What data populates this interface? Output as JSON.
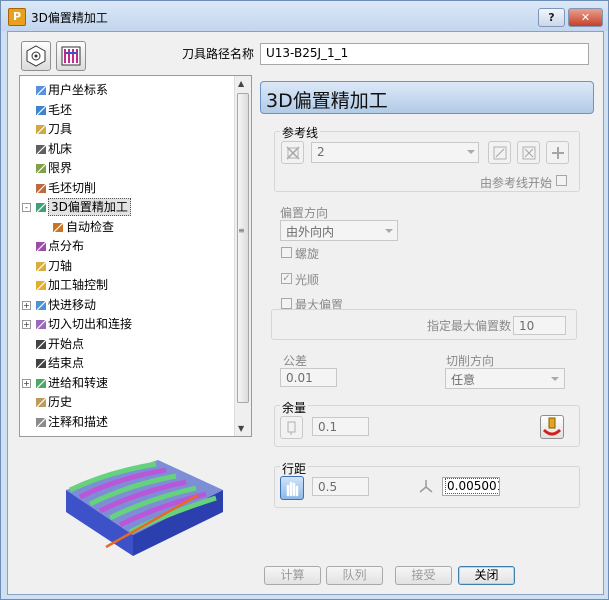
{
  "window": {
    "title": "3D偏置精加工",
    "help_label": "?",
    "close_label": "✕",
    "app_icon_letter": "P"
  },
  "toolpath_name": {
    "label": "刀具路径名称",
    "value": "U13-B25J_1_1"
  },
  "tree": {
    "items": [
      {
        "label": "用户坐标系",
        "icon": "user-coordinate-icon",
        "expander": ""
      },
      {
        "label": "毛坯",
        "icon": "block-icon",
        "expander": ""
      },
      {
        "label": "刀具",
        "icon": "tool-icon",
        "expander": ""
      },
      {
        "label": "机床",
        "icon": "machine-icon",
        "expander": ""
      },
      {
        "label": "限界",
        "icon": "limits-icon",
        "expander": ""
      },
      {
        "label": "毛坯切削",
        "icon": "stock-cut-icon",
        "expander": ""
      },
      {
        "label": "3D偏置精加工",
        "icon": "offset-finish-icon",
        "expander": "-",
        "selected": true
      },
      {
        "label": "自动检查",
        "icon": "auto-check-icon",
        "expander": "",
        "child": true
      },
      {
        "label": "点分布",
        "icon": "point-distribution-icon",
        "expander": ""
      },
      {
        "label": "刀轴",
        "icon": "tool-axis-icon",
        "expander": ""
      },
      {
        "label": "加工轴控制",
        "icon": "axis-control-icon",
        "expander": ""
      },
      {
        "label": "快进移动",
        "icon": "rapid-move-icon",
        "expander": "+"
      },
      {
        "label": "切入切出和连接",
        "icon": "leads-links-icon",
        "expander": "+"
      },
      {
        "label": "开始点",
        "icon": "start-point-icon",
        "expander": ""
      },
      {
        "label": "结束点",
        "icon": "end-point-icon",
        "expander": ""
      },
      {
        "label": "进给和转速",
        "icon": "feeds-speeds-icon",
        "expander": "+"
      },
      {
        "label": "历史",
        "icon": "history-icon",
        "expander": ""
      },
      {
        "label": "注释和描述",
        "icon": "notes-icon",
        "expander": ""
      }
    ]
  },
  "panel": {
    "title": "3D偏置精加工",
    "reference": {
      "group_label": "参考线",
      "value": "2",
      "start_from_ref_label": "由参考线开始"
    },
    "offset_dir": {
      "label": "偏置方向",
      "value": "由外向内"
    },
    "spiral_label": "螺旋",
    "smooth_label": "光顺",
    "max_offset": {
      "label": "最大偏置",
      "limit_label": "指定最大偏置数",
      "value": "10"
    },
    "tolerance": {
      "label": "公差",
      "value": "0.01"
    },
    "cut_direction": {
      "label": "切削方向",
      "value": "任意"
    },
    "allowance": {
      "label": "余量",
      "value": "0.1"
    },
    "stepover": {
      "label": "行距",
      "value": "0.5",
      "stepdown_value": "0.005001"
    }
  },
  "footer": {
    "calculate": "计算",
    "queue": "队列",
    "accept": "接受",
    "close": "关闭"
  },
  "colors": {
    "title_bg": "#c9dcf1",
    "header_bg": "#b7cfe9",
    "stripe_green": "#6bd07a",
    "stripe_purple": "#b657d6",
    "block_blue": "#5a6fd8"
  }
}
